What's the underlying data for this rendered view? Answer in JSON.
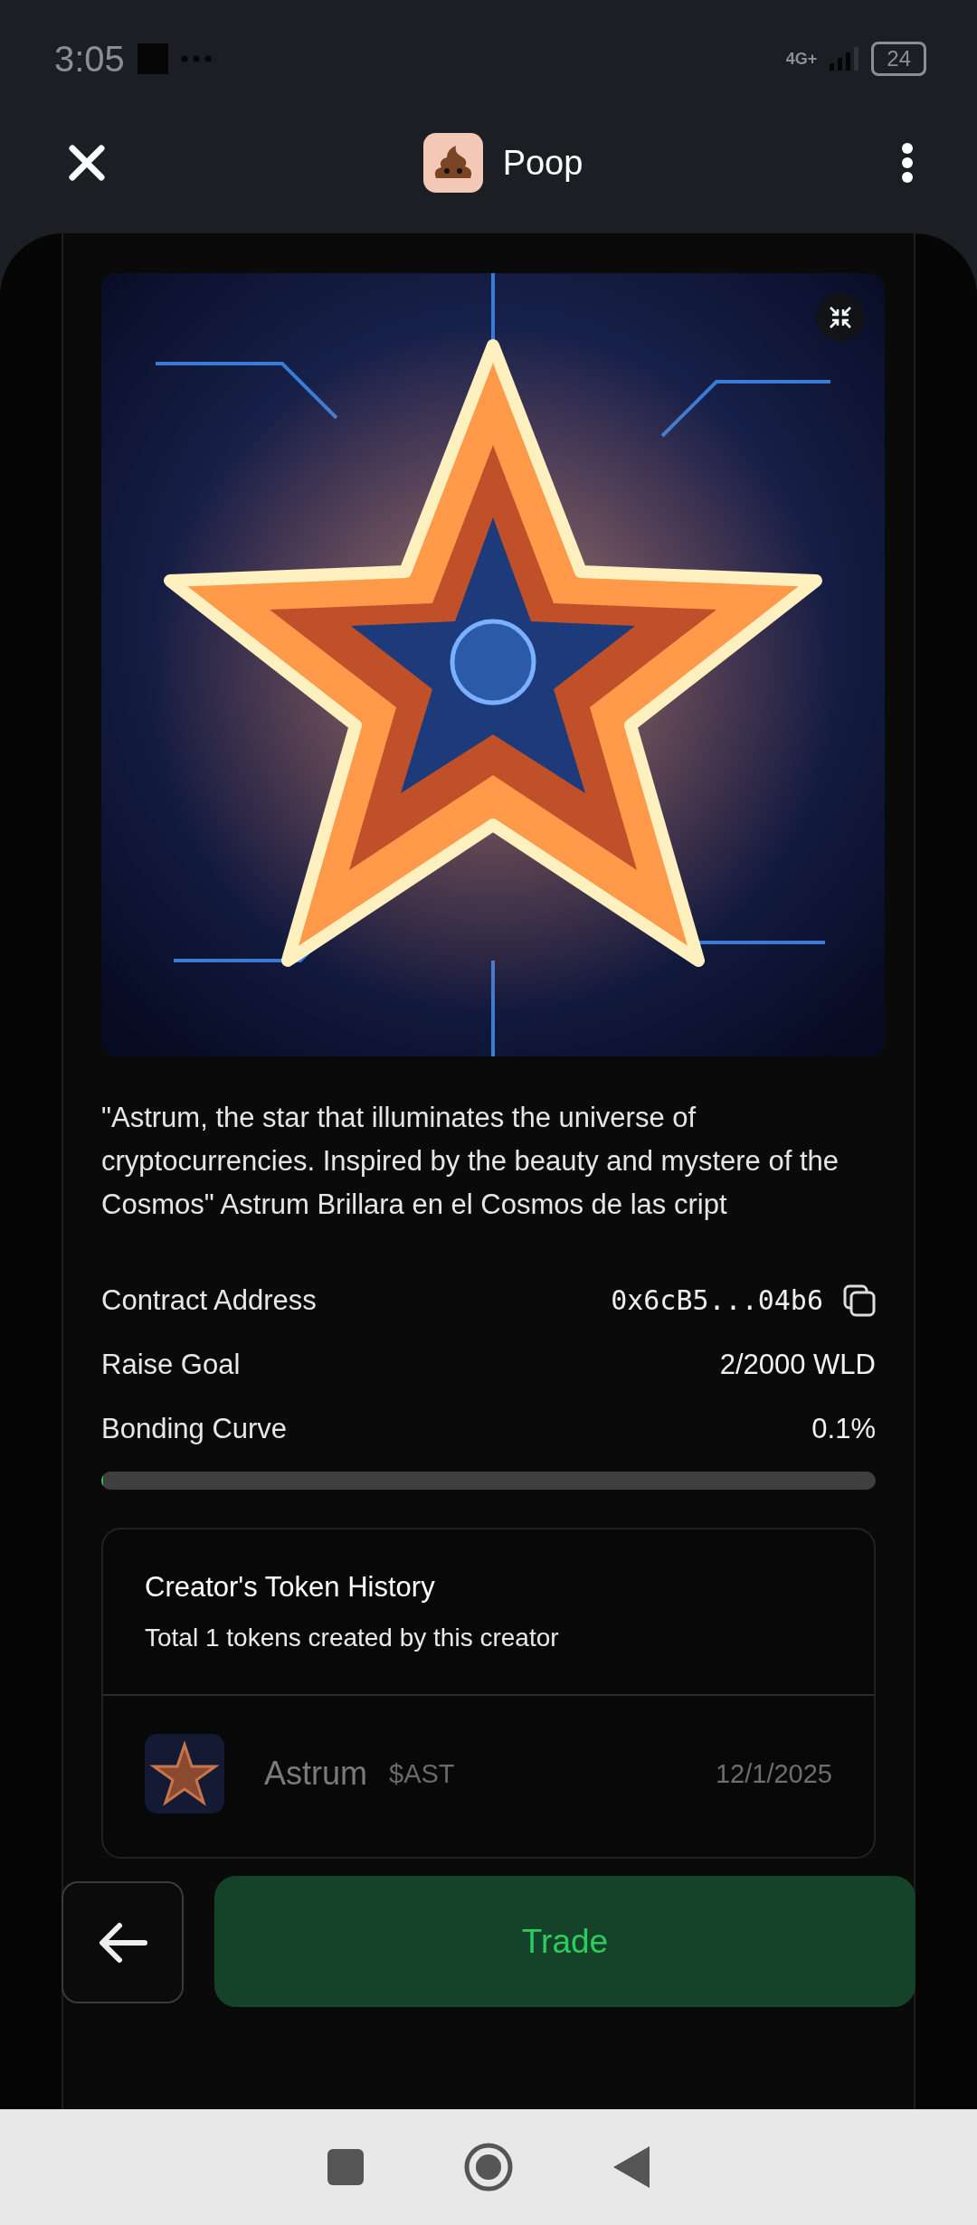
{
  "status_bar": {
    "time": "3:05",
    "network": "4G+",
    "battery": "24"
  },
  "header": {
    "title": "Poop"
  },
  "token": {
    "description": "\"Astrum, the star that illuminates the universe of cryptocurrencies. Inspired by the beauty and mystere of the Cosmos\" Astrum Brillara en el Cosmos de las cript",
    "details": [
      {
        "label": "Contract Address",
        "value": "0x6cB5...04b6",
        "kind": "address"
      },
      {
        "label": "Raise Goal",
        "value": "2/2000 WLD",
        "kind": "plain"
      },
      {
        "label": "Bonding Curve",
        "value": "0.1%",
        "kind": "plain"
      }
    ],
    "bonding_curve": {
      "level": 0.001
    }
  },
  "creator_history": {
    "title": "Creator's Token History",
    "subtitle": "Total 1 tokens created by this creator",
    "tokens": [
      {
        "name": "Astrum",
        "ticker": "$AST",
        "date": "12/1/2025"
      }
    ]
  },
  "actions": {
    "trade": "Trade"
  }
}
